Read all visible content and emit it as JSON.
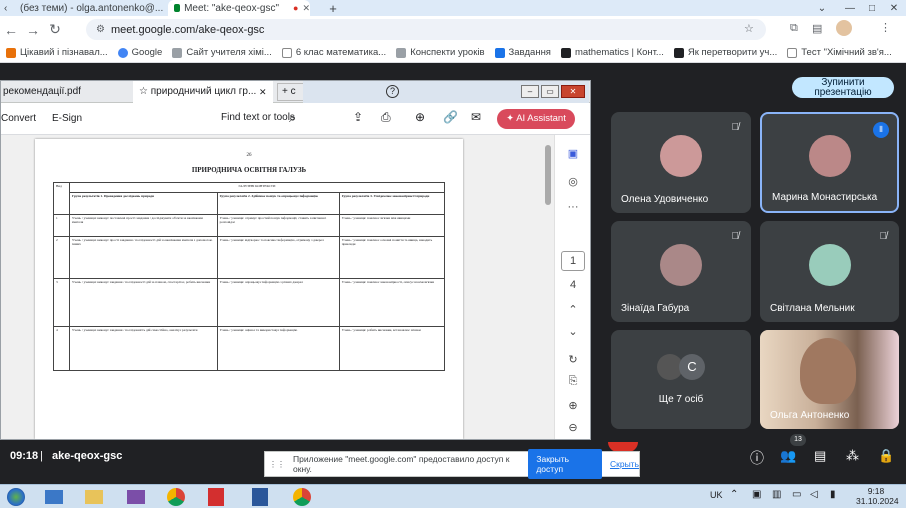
{
  "browser": {
    "tabs": [
      {
        "label": "(без теми) - olga.antonenko@...",
        "active": false
      },
      {
        "label": "Meet: \"ake-qeox-gsc\"",
        "active": true
      }
    ],
    "new_tab_label": "+",
    "url": "meet.google.com/ake-qeox-gsc",
    "bookmarks": [
      {
        "label": "Цікавий і пізнавал...",
        "color": "#e8710a"
      },
      {
        "label": "Google",
        "color": "#4285f4"
      },
      {
        "label": "Сайт учителя хімі...",
        "color": "#9aa0a6"
      },
      {
        "label": "6 клас математика...",
        "color": "#e8eaed"
      },
      {
        "label": "Конспекти уроків",
        "color": "#9aa0a6"
      },
      {
        "label": "Завдання",
        "color": "#1a73e8"
      },
      {
        "label": "mathematics | Конт...",
        "color": "#202124"
      },
      {
        "label": "Як перетворити уч...",
        "color": "#202124"
      },
      {
        "label": "Тест \"Хімічний зв'я...",
        "color": "#e8eaed"
      }
    ]
  },
  "acrobat": {
    "tabs": [
      {
        "label": "рекомендації.pdf"
      },
      {
        "label": "природничий цикл гр..."
      },
      {
        "label": "+ c"
      }
    ],
    "toolbar": {
      "convert": "Convert",
      "esign": "E-Sign",
      "find": "Find text or tools",
      "ai_assistant": "AI Assistant"
    },
    "page_number": "26",
    "doc_title": "ПРИРОДНИЧА ОСВІТНЯ ГАЛУЗЬ",
    "table_header": "ГАЛУЗЕВІ КОНТЕКСТИ",
    "col_row": "Вид",
    "col1": "Група результатів 1. Проведення досліджень природи",
    "col2": "Група результатів 2. Здійснює пошук та опрацьовує інформацію",
    "col3": "Група результатів 3. Усвідомлює закономірності природи",
    "rows": [
      {
        "num": "1",
        "c1": "Учень / учениця: виконує поставлені прості завдання / досліджувати об'єкти за вказівками вчителя",
        "c2": "Учень / учениця: отримує простий пошук інформації, ставить запитання і розповідає",
        "c3": "Учень / учениця: пояснює зв'язки між явищами"
      },
      {
        "num": "2",
        "c1": "Учень / учениця: виконує прості завдання / послідовності дій за вказівками вчителя з допомогою інших",
        "c2": "Учень / учениця: відтворює та пояснює інформацію, отриману з джерел",
        "c3": "Учень / учениця: пояснює основні поняття та явища, наводить приклади"
      },
      {
        "num": "3",
        "c1": "Учень / учениця: виконує завдання / послідовності дій за планом, спостерігає, робить висновки",
        "c2": "Учень / учениця: опрацьовує інформацію з різних джерел",
        "c3": "Учень / учениця: пояснює закономірності, описує взаємозв'язки"
      },
      {
        "num": "4",
        "c1": "Учень / учениця: виконує завдання / послідовність дій самостійно, аналізує результати",
        "c2": "Учень / учениця: оцінює та використовує інформацію",
        "c3": "Учень / учениця: робить висновки, встановлює зв'язки"
      }
    ],
    "rail": {
      "page_current": "1",
      "page_total": "4"
    }
  },
  "meet": {
    "stop_button": "Зупинити презентацію",
    "participants": [
      {
        "name": "Олена Удовиченко",
        "muted": true
      },
      {
        "name": "Марина Монастирська",
        "muted": false
      },
      {
        "name": "Зінаїда Габура",
        "muted": true
      },
      {
        "name": "Світлана Мельник",
        "muted": true
      },
      {
        "name": "Ще 7 осіб",
        "muted": false
      },
      {
        "name": "Ольга Антоненко",
        "muted": false
      }
    ],
    "more_initial": "С",
    "time": "09:18",
    "code": "ake-qeox-gsc",
    "participant_count": "13"
  },
  "notification": {
    "text": "Приложение \"meet.google.com\" предоставило доступ к окну.",
    "close_access": "Закрыть доступ",
    "hide": "Скрыть"
  },
  "taskbar": {
    "lang": "UK",
    "clock_time": "9:18",
    "clock_date": "31.10.2024"
  }
}
